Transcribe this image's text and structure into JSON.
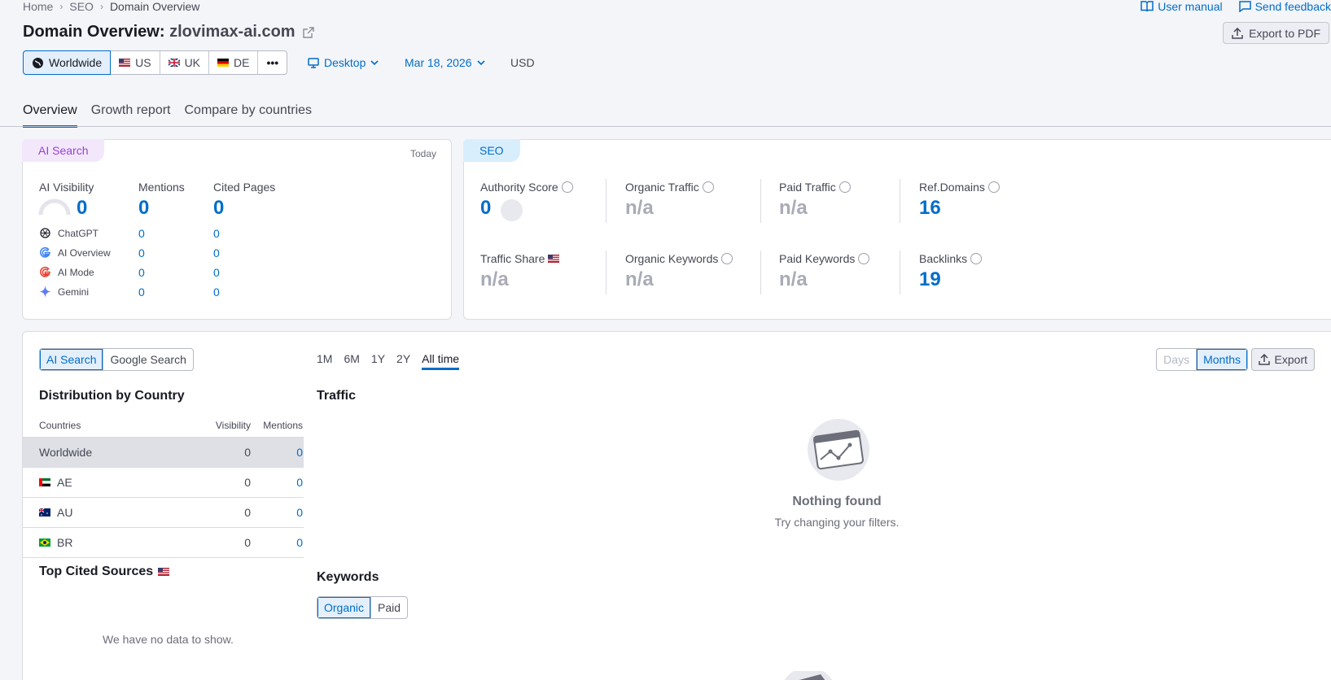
{
  "breadcrumb": [
    "Home",
    "SEO",
    "Domain Overview"
  ],
  "header": {
    "user_manual": "User manual",
    "send_feedback": "Send feedback",
    "title_prefix": "Domain Overview:",
    "domain": "zlovimax-ai.com",
    "export_pdf": "Export to PDF"
  },
  "databases": [
    {
      "label": "Worldwide",
      "icon": "globe-icon"
    },
    {
      "label": "US",
      "icon": "flag-us-icon"
    },
    {
      "label": "UK",
      "icon": "flag-uk-icon"
    },
    {
      "label": "DE",
      "icon": "flag-de-icon"
    }
  ],
  "more_label": "•••",
  "device": "Desktop",
  "date": "Mar 18, 2026",
  "currency": "USD",
  "tabs": [
    "Overview",
    "Growth report",
    "Compare by countries"
  ],
  "ai_search": {
    "badge": "AI Search",
    "today": "Today",
    "metrics": [
      {
        "label": "AI Visibility",
        "value": "0"
      },
      {
        "label": "Mentions",
        "value": "0"
      },
      {
        "label": "Cited Pages",
        "value": "0"
      }
    ],
    "sources": [
      {
        "name": "ChatGPT",
        "mentions": "0",
        "cited": "0"
      },
      {
        "name": "AI Overview",
        "mentions": "0",
        "cited": "0"
      },
      {
        "name": "AI Mode",
        "mentions": "0",
        "cited": "0"
      },
      {
        "name": "Gemini",
        "mentions": "0",
        "cited": "0"
      }
    ]
  },
  "seo": {
    "badge": "SEO",
    "authority_score": {
      "label": "Authority Score",
      "value": "0"
    },
    "organic_traffic": {
      "label": "Organic Traffic",
      "value": "n/a"
    },
    "paid_traffic": {
      "label": "Paid Traffic",
      "value": "n/a"
    },
    "ref_domains": {
      "label": "Ref.Domains",
      "value": "16"
    },
    "traffic_share": {
      "label": "Traffic Share",
      "value": "n/a"
    },
    "organic_keywords": {
      "label": "Organic Keywords",
      "value": "n/a"
    },
    "paid_keywords": {
      "label": "Paid Keywords",
      "value": "n/a"
    },
    "backlinks": {
      "label": "Backlinks",
      "value": "19"
    }
  },
  "bottom": {
    "source_toggle": [
      "AI Search",
      "Google Search"
    ],
    "periods": [
      "1M",
      "6M",
      "1Y",
      "2Y",
      "All time"
    ],
    "granularity": [
      "Days",
      "Months"
    ],
    "export": "Export",
    "distribution_title": "Distribution by Country",
    "table_headers": [
      "Countries",
      "Visibility",
      "Mentions"
    ],
    "rows": [
      {
        "country": "Worldwide",
        "visibility": "0",
        "mentions": "0"
      },
      {
        "country": "AE",
        "visibility": "0",
        "mentions": "0"
      },
      {
        "country": "AU",
        "visibility": "0",
        "mentions": "0"
      },
      {
        "country": "BR",
        "visibility": "0",
        "mentions": "0"
      }
    ],
    "top_cited_title": "Top Cited Sources",
    "no_data": "We have no data to show.",
    "traffic_title": "Traffic",
    "nothing_found": "Nothing found",
    "try_changing": "Try changing your filters.",
    "keywords_title": "Keywords",
    "keyword_toggle": [
      "Organic",
      "Paid"
    ]
  }
}
